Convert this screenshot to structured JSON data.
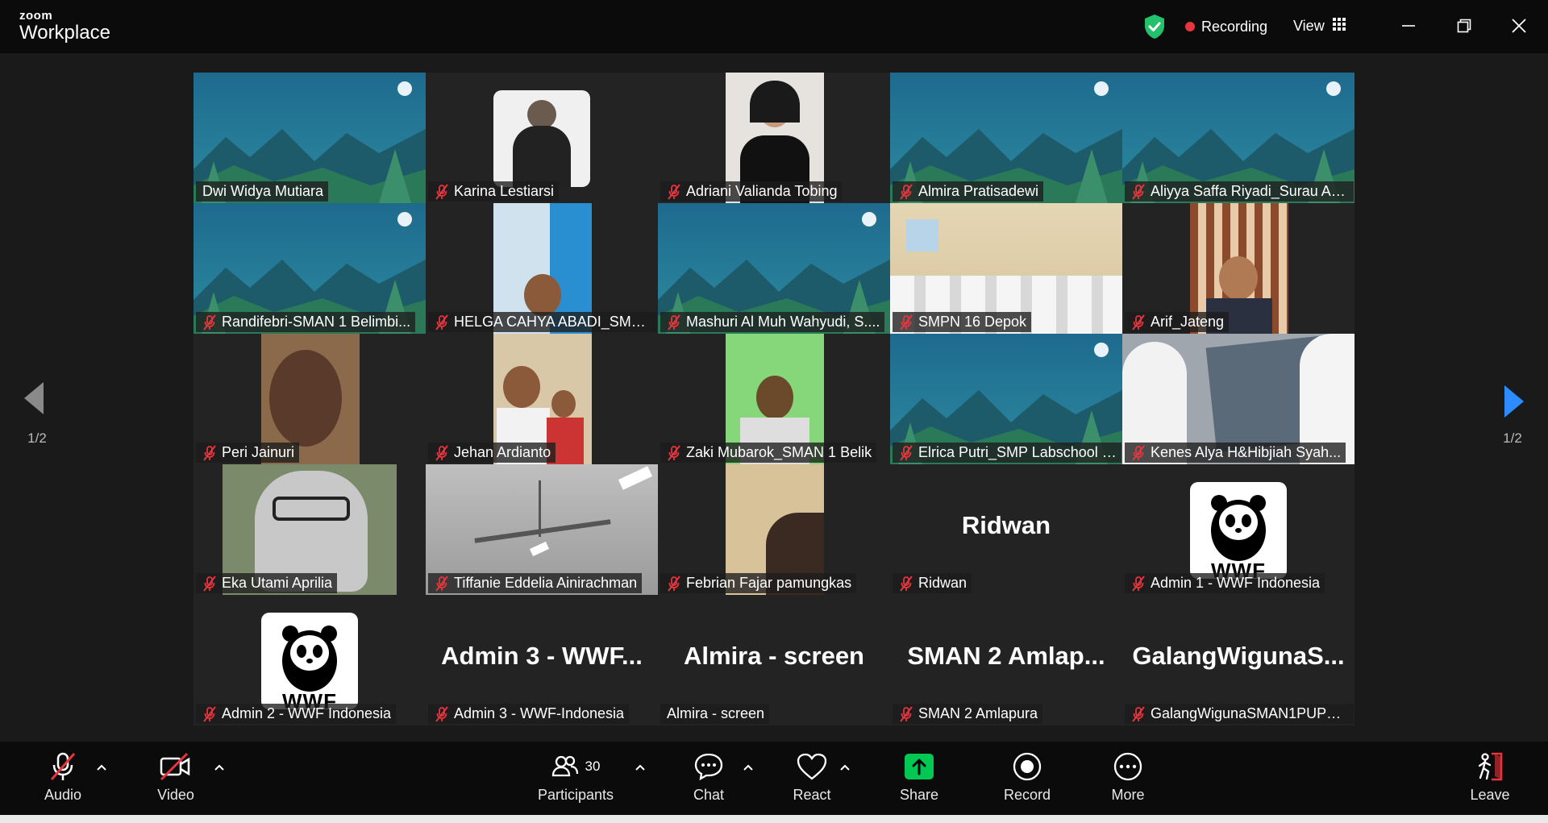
{
  "app": {
    "brand_top": "zoom",
    "brand_main": "Workplace"
  },
  "titlebar": {
    "recording_label": "Recording",
    "view_label": "View"
  },
  "colors": {
    "accent_green": "#23d18b",
    "recording_red": "#e8343c",
    "share_green": "#00c853",
    "muted_red": "#e8343c",
    "nav_blue": "#2d8cff"
  },
  "pager": {
    "left": "1/2",
    "right": "1/2"
  },
  "participants": [
    {
      "name": "Dwi Widya Mutiara",
      "muted": false,
      "active": true,
      "bg": "forest",
      "big": ""
    },
    {
      "name": "Karina Lestiarsi",
      "muted": true,
      "active": false,
      "bg": "portrait-white",
      "big": ""
    },
    {
      "name": "Adriani Valianda Tobing",
      "muted": true,
      "active": false,
      "bg": "portrait-room",
      "big": ""
    },
    {
      "name": "Almira Pratisadewi",
      "muted": true,
      "active": false,
      "bg": "forest",
      "big": ""
    },
    {
      "name": "Aliyya Saffa Riyadi_Surau Ac...",
      "muted": true,
      "active": false,
      "bg": "forest",
      "big": ""
    },
    {
      "name": "Randifebri-SMAN 1 Belimbi...",
      "muted": true,
      "active": false,
      "bg": "forest",
      "big": ""
    },
    {
      "name": "HELGA CAHYA ABADI_SMKN...",
      "muted": true,
      "active": false,
      "bg": "portrait-blue",
      "big": ""
    },
    {
      "name": "Mashuri Al Muh Wahyudi, S....",
      "muted": true,
      "active": false,
      "bg": "forest",
      "big": ""
    },
    {
      "name": "SMPN 16 Depok",
      "muted": true,
      "active": false,
      "bg": "classroom",
      "big": ""
    },
    {
      "name": "Arif_Jateng",
      "muted": true,
      "active": false,
      "bg": "portrait-wood",
      "big": ""
    },
    {
      "name": "Peri Jainuri",
      "muted": true,
      "active": false,
      "bg": "portrait-dark",
      "big": ""
    },
    {
      "name": "Jehan Ardianto",
      "muted": true,
      "active": false,
      "bg": "portrait-class",
      "big": ""
    },
    {
      "name": "Zaki Mubarok_SMAN 1 Belik",
      "muted": true,
      "active": false,
      "bg": "portrait-green",
      "big": ""
    },
    {
      "name": "Elrica Putri_SMP Labschool J...",
      "muted": true,
      "active": false,
      "bg": "forest",
      "big": ""
    },
    {
      "name": "Kenes Alya H&Hibjiah Syah...",
      "muted": true,
      "active": false,
      "bg": "wide-light",
      "big": ""
    },
    {
      "name": "Eka Utami Aprilia",
      "muted": true,
      "active": false,
      "bg": "portrait-outdoor",
      "big": ""
    },
    {
      "name": "Tiffanie Eddelia Ainirachman",
      "muted": true,
      "active": false,
      "bg": "ceiling",
      "big": ""
    },
    {
      "name": "Febrian Fajar pamungkas",
      "muted": true,
      "active": false,
      "bg": "portrait-beige",
      "big": ""
    },
    {
      "name": "Ridwan",
      "muted": true,
      "active": false,
      "bg": "none",
      "big": "Ridwan"
    },
    {
      "name": "Admin 1 - WWF Indonesia",
      "muted": true,
      "active": false,
      "bg": "wwf",
      "big": ""
    },
    {
      "name": "Admin 2 - WWF Indonesia",
      "muted": true,
      "active": false,
      "bg": "wwf",
      "big": ""
    },
    {
      "name": "Admin 3 - WWF-Indonesia",
      "muted": true,
      "active": false,
      "bg": "none",
      "big": "Admin 3 - WWF..."
    },
    {
      "name": "Almira - screen",
      "muted": false,
      "active": false,
      "bg": "none",
      "big": "Almira - screen"
    },
    {
      "name": "SMAN 2 Amlapura",
      "muted": true,
      "active": false,
      "bg": "none",
      "big": "SMAN 2 Amlap..."
    },
    {
      "name": "GalangWigunaSMAN1PUPU...",
      "muted": true,
      "active": false,
      "bg": "none",
      "big": "GalangWigunaS..."
    }
  ],
  "wwf_logo_text": "WWF",
  "toolbar": {
    "audio": "Audio",
    "video": "Video",
    "participants": "Participants",
    "participants_count": "30",
    "chat": "Chat",
    "react": "React",
    "share": "Share",
    "record": "Record",
    "more": "More",
    "leave": "Leave"
  },
  "icons": {
    "shield": "shield-check-icon",
    "recording": "recording-dot-icon",
    "view": "grid-icon",
    "minimize": "minimize-icon",
    "restore": "restore-icon",
    "close": "close-icon"
  }
}
